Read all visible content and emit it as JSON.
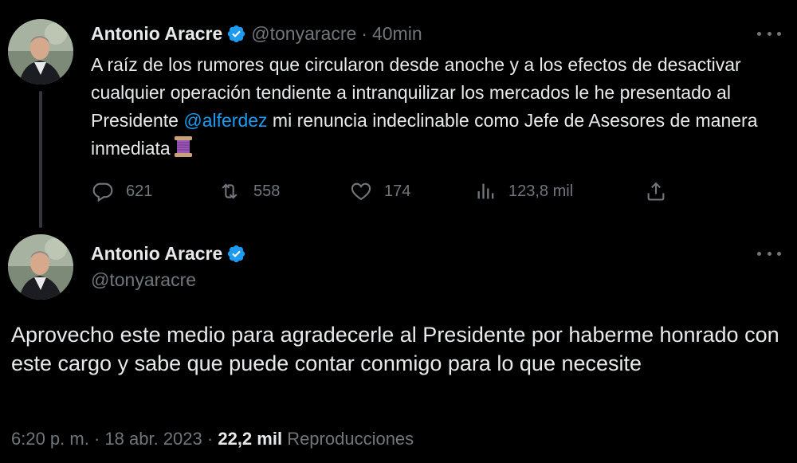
{
  "tweet1": {
    "author_name": "Antonio Aracre",
    "author_handle": "@tonyaracre",
    "separator": "·",
    "time": "40min",
    "text_before": "A raíz de los rumores que circularon desde anoche y a los efectos de desactivar cualquier operación tendiente a intranquilizar los mercados  le he presentado al Presidente ",
    "mention": "@alferdez",
    "text_after": " mi renuncia indeclinable como Jefe de Asesores de manera inmediata",
    "emoji": "spool-of-thread",
    "replies": "621",
    "retweets": "558",
    "likes": "174",
    "views": "123,8 mil",
    "icons": [
      "reply-icon",
      "retweet-icon",
      "like-icon",
      "views-icon",
      "share-icon",
      "more-icon",
      "verified-badge-icon"
    ]
  },
  "tweet2": {
    "author_name": "Antonio Aracre",
    "author_handle": "@tonyaracre",
    "text": "Aprovecho este medio para agradecerle al Presidente por haberme honrado con este cargo y sabe que puede contar conmigo para lo que necesite",
    "time": "6:20 p. m.",
    "date": "18 abr. 2023",
    "separator": "·",
    "views_count": "22,2 mil",
    "views_label": "Reproducciones"
  },
  "colors": {
    "background": "#000000",
    "text": "#e7e9ea",
    "secondary": "#71767b",
    "accent": "#1d9bf0",
    "thread_line": "#333639"
  }
}
